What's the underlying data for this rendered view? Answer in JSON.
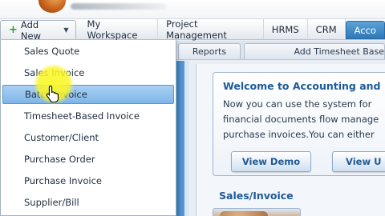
{
  "header": {
    "add_new": {
      "label": "Add New",
      "plus_icon": "+",
      "chevron_icon": "▼"
    },
    "nav_items": [
      {
        "label": "My Workspace"
      },
      {
        "label": "Project Management"
      },
      {
        "label": "HRMS"
      },
      {
        "label": "CRM"
      },
      {
        "label": "Acco"
      }
    ],
    "active_color": "#3a84c4"
  },
  "subnav": {
    "tabs": [
      {
        "label": "Reports"
      },
      {
        "label": "Add Timesheet Base"
      }
    ]
  },
  "dropdown": {
    "items": [
      {
        "label": "Sales Quote"
      },
      {
        "label": "Sales Invoice"
      },
      {
        "label": "Batch Invoice"
      },
      {
        "label": "Timesheet-Based Invoice"
      },
      {
        "label": "Customer/Client"
      },
      {
        "label": "Purchase Order"
      },
      {
        "label": "Purchase Invoice"
      },
      {
        "label": "Supplier/Bill"
      }
    ],
    "selected_index": 2
  },
  "welcome": {
    "title": "Welcome to Accounting and I",
    "lines": [
      "Now you can use the system for",
      "financial documents flow manage",
      "purchase invoices.You can either"
    ],
    "buttons": {
      "demo": "View Demo",
      "view": "View U"
    }
  },
  "section": {
    "title": "Sales/Invoice"
  },
  "colors": {
    "title_blue": "#1e5a98",
    "highlight_yellow": "#f7f232",
    "selected_blue": "#8fc1ee"
  }
}
